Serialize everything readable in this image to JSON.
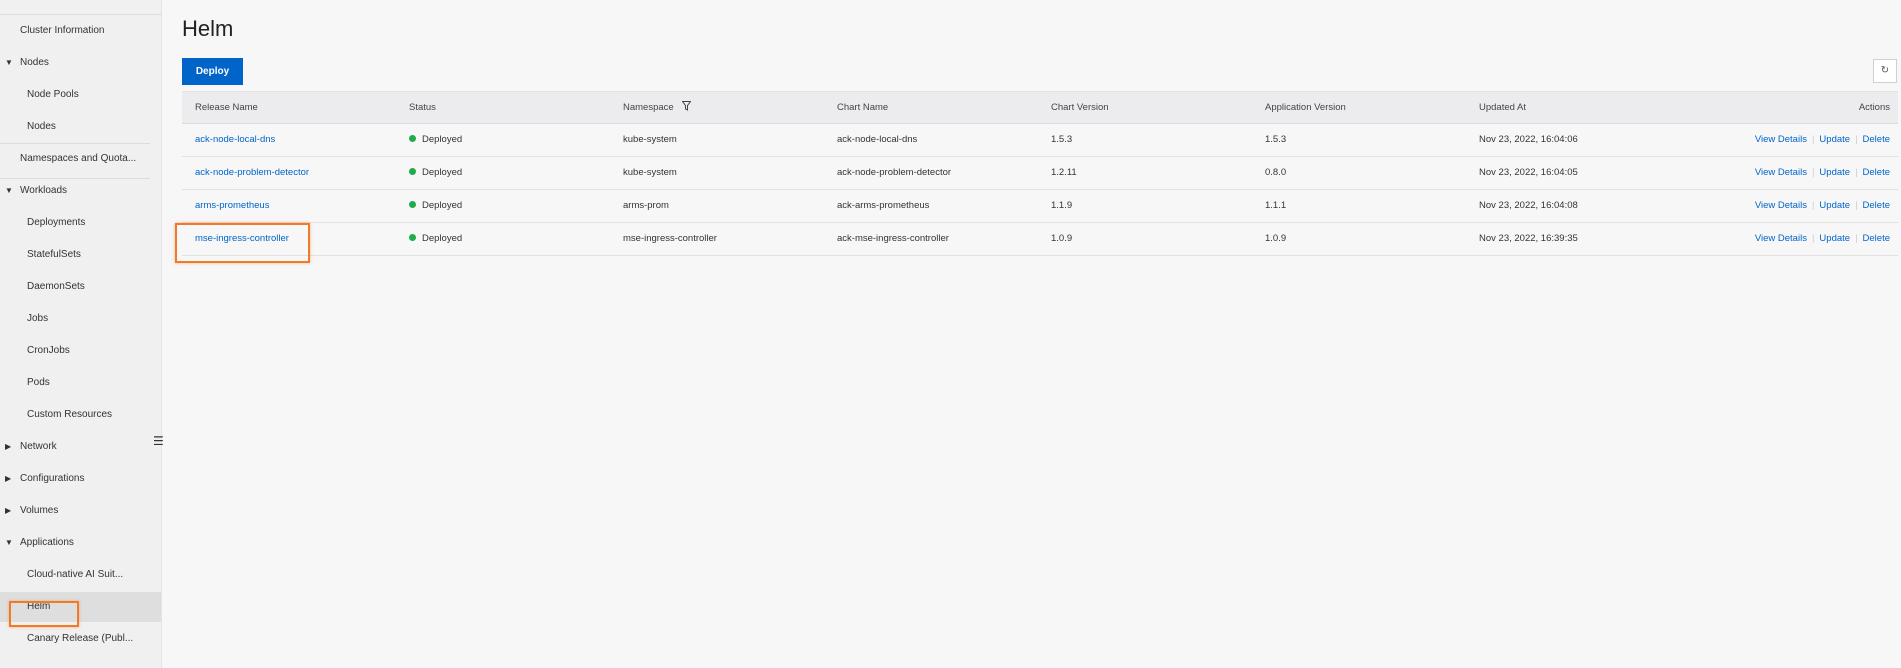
{
  "sidebar": {
    "items": [
      {
        "label": "Cluster Information",
        "level": "top",
        "expand": ""
      },
      {
        "label": "Nodes",
        "level": "top",
        "expand": "expanded"
      },
      {
        "label": "Node Pools",
        "level": "sub"
      },
      {
        "label": "Nodes",
        "level": "sub"
      },
      {
        "label": "Namespaces and Quota...",
        "level": "top",
        "expand": ""
      },
      {
        "label": "Workloads",
        "level": "top",
        "expand": "expanded"
      },
      {
        "label": "Deployments",
        "level": "sub"
      },
      {
        "label": "StatefulSets",
        "level": "sub"
      },
      {
        "label": "DaemonSets",
        "level": "sub"
      },
      {
        "label": "Jobs",
        "level": "sub"
      },
      {
        "label": "CronJobs",
        "level": "sub"
      },
      {
        "label": "Pods",
        "level": "sub"
      },
      {
        "label": "Custom Resources",
        "level": "sub"
      },
      {
        "label": "Network",
        "level": "top",
        "expand": "collapsed"
      },
      {
        "label": "Configurations",
        "level": "top",
        "expand": "collapsed"
      },
      {
        "label": "Volumes",
        "level": "top",
        "expand": "collapsed"
      },
      {
        "label": "Applications",
        "level": "top",
        "expand": "expanded"
      },
      {
        "label": "Cloud-native AI Suit...",
        "level": "sub"
      },
      {
        "label": "Helm",
        "level": "sub",
        "active": true
      },
      {
        "label": "Canary Release (Publ...",
        "level": "sub"
      }
    ]
  },
  "page": {
    "title": "Helm",
    "deploy_label": "Deploy",
    "refresh_icon": "refresh-icon"
  },
  "table": {
    "headers": [
      "Release Name",
      "Status",
      "Namespace",
      "Chart Name",
      "Chart Version",
      "Application Version",
      "Updated At",
      "Actions"
    ],
    "rows": [
      {
        "release": "ack-node-local-dns",
        "status": "Deployed",
        "namespace": "kube-system",
        "chart": "ack-node-local-dns",
        "chart_version": "1.5.3",
        "app_version": "1.5.3",
        "updated": "Nov 23, 2022, 16:04:06"
      },
      {
        "release": "ack-node-problem-detector",
        "status": "Deployed",
        "namespace": "kube-system",
        "chart": "ack-node-problem-detector",
        "chart_version": "1.2.11",
        "app_version": "0.8.0",
        "updated": "Nov 23, 2022, 16:04:05"
      },
      {
        "release": "arms-prometheus",
        "status": "Deployed",
        "namespace": "arms-prom",
        "chart": "ack-arms-prometheus",
        "chart_version": "1.1.9",
        "app_version": "1.1.1",
        "updated": "Nov 23, 2022, 16:04:08"
      },
      {
        "release": "mse-ingress-controller",
        "status": "Deployed",
        "namespace": "mse-ingress-controller",
        "chart": "ack-mse-ingress-controller",
        "chart_version": "1.0.9",
        "app_version": "1.0.9",
        "updated": "Nov 23, 2022, 16:39:35"
      }
    ],
    "actions": {
      "view": "View Details",
      "update": "Update",
      "delete": "Delete"
    }
  },
  "colors": {
    "accent": "#0064c8",
    "status_ok": "#1fad4a",
    "highlight": "#f07a2a"
  }
}
